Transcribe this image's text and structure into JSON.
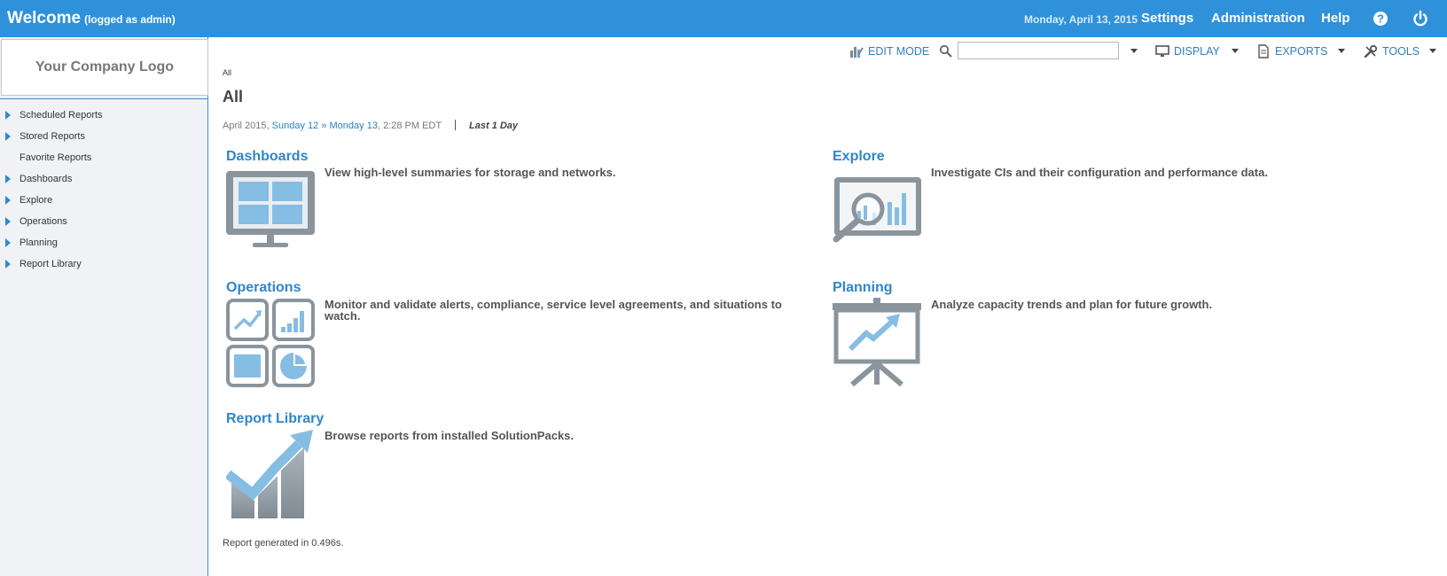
{
  "topbar": {
    "welcome": "Welcome",
    "logged_as": "(logged as admin)",
    "date": "Monday, April 13, 2015",
    "links": {
      "settings": "Settings",
      "administration": "Administration",
      "help": "Help"
    },
    "icons": [
      "help-circle-icon",
      "power-icon"
    ]
  },
  "sidebar": {
    "logo": "Your Company Logo",
    "items": [
      {
        "label": "Scheduled Reports",
        "has_arrow": true
      },
      {
        "label": "Stored Reports",
        "has_arrow": true
      },
      {
        "label": "Favorite Reports",
        "has_arrow": false
      },
      {
        "label": "Dashboards",
        "has_arrow": true
      },
      {
        "label": "Explore",
        "has_arrow": true
      },
      {
        "label": "Operations",
        "has_arrow": true
      },
      {
        "label": "Planning",
        "has_arrow": true
      },
      {
        "label": "Report Library",
        "has_arrow": true
      }
    ]
  },
  "toolbar": {
    "edit_mode": "EDIT MODE",
    "search_value": "",
    "display": "DISPLAY",
    "exports": "EXPORTS",
    "tools": "TOOLS"
  },
  "main": {
    "breadcrumb": "All",
    "title": "All",
    "date_prefix": "April 2015,",
    "date_from": "Sunday 12",
    "date_sep": "»",
    "date_to": "Monday 13",
    "date_time": ", 2:28 PM EDT",
    "period": "Last 1 Day",
    "tiles": {
      "dashboards": {
        "title": "Dashboards",
        "desc": "View high-level summaries for storage and networks."
      },
      "explore": {
        "title": "Explore",
        "desc": "Investigate CIs and their configuration and performance data."
      },
      "operations": {
        "title": "Operations",
        "desc": "Monitor and validate alerts, compliance, service level agreements, and situations to watch."
      },
      "planning": {
        "title": "Planning",
        "desc": "Analyze capacity trends and plan for future growth."
      },
      "report_library": {
        "title": "Report Library",
        "desc": "Browse reports from installed SolutionPacks."
      }
    },
    "footer": "Report generated in 0.496s."
  },
  "colors": {
    "topbar": "#2e91d9",
    "link": "#2e86cc",
    "icon_gray": "#8a949c",
    "icon_blue": "#86bde3"
  }
}
